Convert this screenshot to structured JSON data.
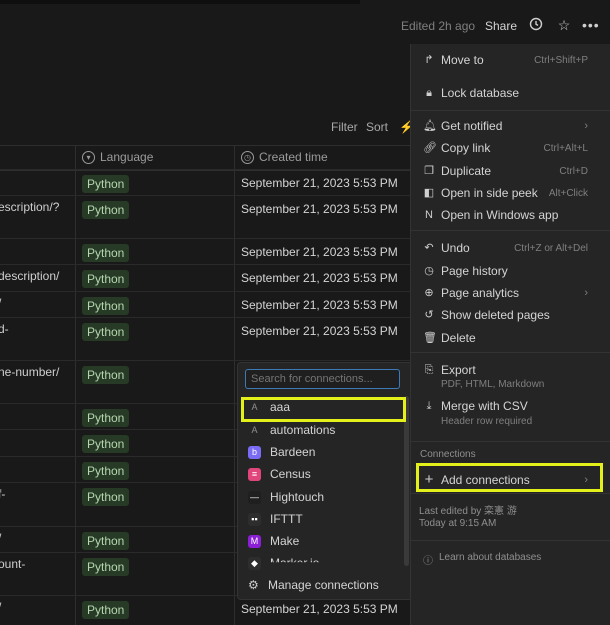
{
  "topbar": {
    "edited": "Edited 2h ago",
    "share": "Share",
    "icons": [
      "clock-icon",
      "star-icon",
      "more-icon"
    ]
  },
  "toolbar": {
    "filter": "Filter",
    "sort": "Sort"
  },
  "table": {
    "headers": {
      "language": "Language",
      "created": "Created time"
    },
    "rows": [
      {
        "url": "",
        "language": "Python",
        "created": "September 21, 2023 5:53 PM"
      },
      {
        "url": "escription/?",
        "language": "Python",
        "created": "September 21, 2023 5:53 PM"
      },
      {
        "url": "",
        "language": "Python",
        "created": "September 21, 2023 5:53 PM"
      },
      {
        "url": "description/",
        "language": "Python",
        "created": "September 21, 2023 5:53 PM"
      },
      {
        "url": "/",
        "language": "Python",
        "created": "September 21, 2023 5:53 PM"
      },
      {
        "url": "d-",
        "language": "Python",
        "created": "September 21, 2023 5:53 PM"
      },
      {
        "url": "ne-number/",
        "language": "Python",
        "created": ""
      },
      {
        "url": "",
        "language": "Python",
        "created": ""
      },
      {
        "url": "",
        "language": "Python",
        "created": ""
      },
      {
        "url": "",
        "language": "Python",
        "created": ""
      },
      {
        "url": "f-",
        "language": "Python",
        "created": ""
      },
      {
        "url": "/",
        "language": "Python",
        "created": ""
      },
      {
        "url": "ount-",
        "language": "Python",
        "created": ""
      },
      {
        "url": "/",
        "language": "Python",
        "created": "September 21, 2023 5:53 PM"
      }
    ]
  },
  "menu": {
    "items": [
      {
        "label": "Move to",
        "shortcut": "Ctrl+Shift+P",
        "icon": "move-icon"
      },
      {
        "label": "Lock database",
        "shortcut": "",
        "icon": "lock-icon"
      },
      {
        "label": "Get notified",
        "shortcut": "",
        "icon": "bell-icon"
      },
      {
        "label": "Copy link",
        "shortcut": "Ctrl+Alt+L",
        "icon": "link-icon"
      },
      {
        "label": "Duplicate",
        "shortcut": "Ctrl+D",
        "icon": "duplicate-icon"
      },
      {
        "label": "Open in side peek",
        "shortcut": "Alt+Click",
        "icon": "side-peek-icon"
      },
      {
        "label": "Open in Windows app",
        "shortcut": "",
        "icon": "notion-icon"
      },
      {
        "label": "Undo",
        "shortcut": "Ctrl+Z or Alt+Del",
        "icon": "undo-icon"
      },
      {
        "label": "Page history",
        "shortcut": "",
        "icon": "history-icon"
      },
      {
        "label": "Page analytics",
        "shortcut": "",
        "icon": "analytics-icon"
      },
      {
        "label": "Show deleted pages",
        "shortcut": "",
        "icon": "restore-icon"
      },
      {
        "label": "Delete",
        "shortcut": "",
        "icon": "trash-icon"
      },
      {
        "label": "Export",
        "shortcut": "",
        "icon": "export-icon"
      },
      {
        "label": "Merge with CSV",
        "shortcut": "",
        "icon": "merge-icon"
      }
    ],
    "export_sub": "PDF, HTML, Markdown",
    "merge_sub": "Header row required",
    "connections_label": "Connections",
    "add_connections": "Add connections",
    "last_edited": "Last edited by 栾憲 游",
    "last_edited_time": "Today at 9:15 AM",
    "learn": "Learn about databases"
  },
  "connections": {
    "search_placeholder": "Search for connections...",
    "items": [
      {
        "label": "aaa",
        "icon": "letter-a-icon",
        "color": "#3a3a3a"
      },
      {
        "label": "automations",
        "icon": "letter-a-icon",
        "color": "#3a3a3a"
      },
      {
        "label": "Bardeen",
        "icon": "bardeen-icon",
        "color": "#7b6cf6"
      },
      {
        "label": "Census",
        "icon": "census-icon",
        "color": "#e0457b"
      },
      {
        "label": "Hightouch",
        "icon": "hightouch-icon",
        "color": "#1f1f1f"
      },
      {
        "label": "IFTTT",
        "icon": "ifttt-icon",
        "color": "#2d2d2d"
      },
      {
        "label": "Make",
        "icon": "make-icon",
        "color": "#8a1fd6"
      },
      {
        "label": "Marker.io",
        "icon": "marker-icon",
        "color": "#2d2d2d"
      }
    ],
    "manage": "Manage connections"
  },
  "colors": {
    "highlight": "#e3f01a",
    "tag_bg": "#263a26"
  }
}
